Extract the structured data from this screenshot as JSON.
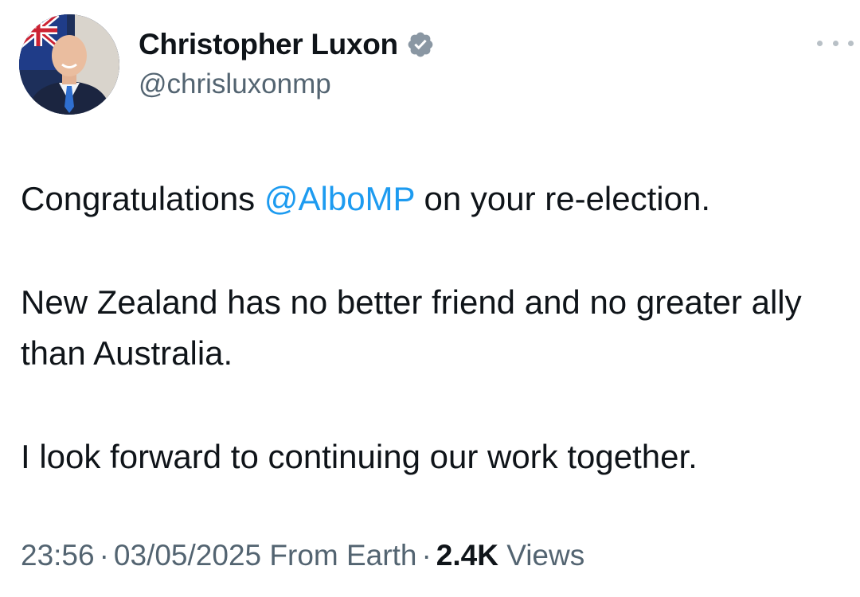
{
  "author": {
    "display_name": "Christopher Luxon",
    "handle": "@chrisluxonmp",
    "verified_icon": "verified-badge-icon",
    "avatar_icon": "profile-photo"
  },
  "tweet": {
    "line1_prefix": "Congratulations ",
    "mention": "@AlboMP",
    "line1_suffix": " on your re-election.",
    "paragraph2": "New Zealand has no better friend and no greater ally than Australia.",
    "paragraph3": "I look forward to continuing our work together."
  },
  "meta": {
    "time": "23:56",
    "separator": "·",
    "date": "03/05/2025",
    "source": "From Earth",
    "views_count": "2.4K",
    "views_label": "Views"
  },
  "colors": {
    "mention": "#1d9bf0",
    "secondary_text": "#536471",
    "primary_text": "#0f1419",
    "badge": "#8a97a3"
  }
}
